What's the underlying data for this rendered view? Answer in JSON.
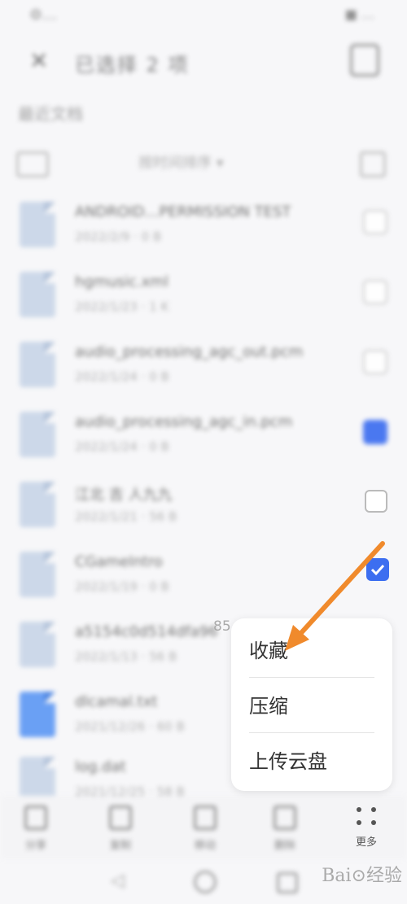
{
  "status_bar": {
    "left": "⚙…",
    "right": "■ …"
  },
  "header": {
    "title": "已选择 2 项",
    "close": "✕"
  },
  "section": "最近文档",
  "toolbar": {
    "sort_label": "按时间排序 ▾"
  },
  "files": [
    {
      "name": "ANDROID…PERMISSION TEST",
      "meta": "2022/2/9 · 0 B",
      "checked": false
    },
    {
      "name": "hgmusic.xml",
      "meta": "2022/1/23 · 1 K",
      "checked": false
    },
    {
      "name": "audio_processing_agc_out.pcm",
      "meta": "2022/1/24 · 0 B",
      "checked": false
    },
    {
      "name": "audio_processing_agc_in.pcm",
      "meta": "2022/1/24 · 0 B",
      "checked": true
    },
    {
      "name": "江北 吉 人九九",
      "meta": "2022/1/21 · 56 B",
      "checked": false
    },
    {
      "name": "CGameIntro",
      "meta": "2022/1/19 · 0 B",
      "checked": true
    },
    {
      "name": "a5154c0d514dfa96",
      "meta": "2022/1/13 · 56 B",
      "checked": false
    },
    {
      "name": "dlcamal.txt",
      "meta": "2021/12/26 · 60 B",
      "checked": false,
      "blue": true
    },
    {
      "name": "log.dat",
      "meta": "2021/12/25 · 58 B",
      "checked": false
    }
  ],
  "stray_number": "85",
  "popup": {
    "items": [
      "收藏",
      "压缩",
      "上传云盘"
    ]
  },
  "bottom_actions": [
    {
      "label": "分享",
      "icon": "share-icon"
    },
    {
      "label": "复制",
      "icon": "copy-icon"
    },
    {
      "label": "移动",
      "icon": "move-icon"
    },
    {
      "label": "删除",
      "icon": "delete-icon"
    }
  ],
  "more_label": "更多",
  "watermark": "Bai⊙经验",
  "colors": {
    "accent": "#3c6ef0",
    "arrow": "#f08a2c",
    "file_icon": "#c9d6e8"
  }
}
